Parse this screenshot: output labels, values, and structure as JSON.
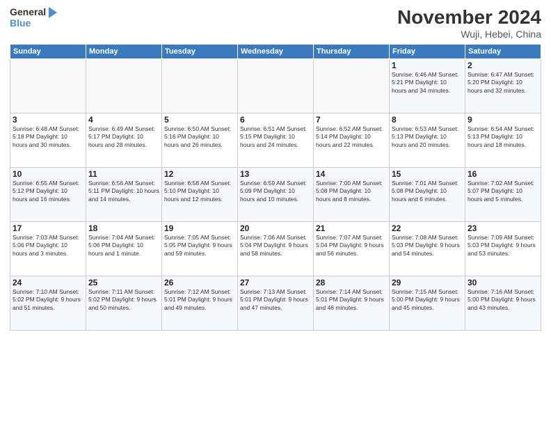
{
  "header": {
    "logo_general": "General",
    "logo_blue": "Blue",
    "month_title": "November 2024",
    "location": "Wuji, Hebei, China"
  },
  "weekdays": [
    "Sunday",
    "Monday",
    "Tuesday",
    "Wednesday",
    "Thursday",
    "Friday",
    "Saturday"
  ],
  "weeks": [
    [
      {
        "day": "",
        "info": ""
      },
      {
        "day": "",
        "info": ""
      },
      {
        "day": "",
        "info": ""
      },
      {
        "day": "",
        "info": ""
      },
      {
        "day": "",
        "info": ""
      },
      {
        "day": "1",
        "info": "Sunrise: 6:46 AM\nSunset: 5:21 PM\nDaylight: 10 hours\nand 34 minutes."
      },
      {
        "day": "2",
        "info": "Sunrise: 6:47 AM\nSunset: 5:20 PM\nDaylight: 10 hours\nand 32 minutes."
      }
    ],
    [
      {
        "day": "3",
        "info": "Sunrise: 6:48 AM\nSunset: 5:18 PM\nDaylight: 10 hours\nand 30 minutes."
      },
      {
        "day": "4",
        "info": "Sunrise: 6:49 AM\nSunset: 5:17 PM\nDaylight: 10 hours\nand 28 minutes."
      },
      {
        "day": "5",
        "info": "Sunrise: 6:50 AM\nSunset: 5:16 PM\nDaylight: 10 hours\nand 26 minutes."
      },
      {
        "day": "6",
        "info": "Sunrise: 6:51 AM\nSunset: 5:15 PM\nDaylight: 10 hours\nand 24 minutes."
      },
      {
        "day": "7",
        "info": "Sunrise: 6:52 AM\nSunset: 5:14 PM\nDaylight: 10 hours\nand 22 minutes."
      },
      {
        "day": "8",
        "info": "Sunrise: 6:53 AM\nSunset: 5:13 PM\nDaylight: 10 hours\nand 20 minutes."
      },
      {
        "day": "9",
        "info": "Sunrise: 6:54 AM\nSunset: 5:13 PM\nDaylight: 10 hours\nand 18 minutes."
      }
    ],
    [
      {
        "day": "10",
        "info": "Sunrise: 6:55 AM\nSunset: 5:12 PM\nDaylight: 10 hours\nand 16 minutes."
      },
      {
        "day": "11",
        "info": "Sunrise: 6:56 AM\nSunset: 5:11 PM\nDaylight: 10 hours\nand 14 minutes."
      },
      {
        "day": "12",
        "info": "Sunrise: 6:58 AM\nSunset: 5:10 PM\nDaylight: 10 hours\nand 12 minutes."
      },
      {
        "day": "13",
        "info": "Sunrise: 6:59 AM\nSunset: 5:09 PM\nDaylight: 10 hours\nand 10 minutes."
      },
      {
        "day": "14",
        "info": "Sunrise: 7:00 AM\nSunset: 5:08 PM\nDaylight: 10 hours\nand 8 minutes."
      },
      {
        "day": "15",
        "info": "Sunrise: 7:01 AM\nSunset: 5:08 PM\nDaylight: 10 hours\nand 6 minutes."
      },
      {
        "day": "16",
        "info": "Sunrise: 7:02 AM\nSunset: 5:07 PM\nDaylight: 10 hours\nand 5 minutes."
      }
    ],
    [
      {
        "day": "17",
        "info": "Sunrise: 7:03 AM\nSunset: 5:06 PM\nDaylight: 10 hours\nand 3 minutes."
      },
      {
        "day": "18",
        "info": "Sunrise: 7:04 AM\nSunset: 5:06 PM\nDaylight: 10 hours\nand 1 minute."
      },
      {
        "day": "19",
        "info": "Sunrise: 7:05 AM\nSunset: 5:05 PM\nDaylight: 9 hours\nand 59 minutes."
      },
      {
        "day": "20",
        "info": "Sunrise: 7:06 AM\nSunset: 5:04 PM\nDaylight: 9 hours\nand 58 minutes."
      },
      {
        "day": "21",
        "info": "Sunrise: 7:07 AM\nSunset: 5:04 PM\nDaylight: 9 hours\nand 56 minutes."
      },
      {
        "day": "22",
        "info": "Sunrise: 7:08 AM\nSunset: 5:03 PM\nDaylight: 9 hours\nand 54 minutes."
      },
      {
        "day": "23",
        "info": "Sunrise: 7:09 AM\nSunset: 5:03 PM\nDaylight: 9 hours\nand 53 minutes."
      }
    ],
    [
      {
        "day": "24",
        "info": "Sunrise: 7:10 AM\nSunset: 5:02 PM\nDaylight: 9 hours\nand 51 minutes."
      },
      {
        "day": "25",
        "info": "Sunrise: 7:11 AM\nSunset: 5:02 PM\nDaylight: 9 hours\nand 50 minutes."
      },
      {
        "day": "26",
        "info": "Sunrise: 7:12 AM\nSunset: 5:01 PM\nDaylight: 9 hours\nand 49 minutes."
      },
      {
        "day": "27",
        "info": "Sunrise: 7:13 AM\nSunset: 5:01 PM\nDaylight: 9 hours\nand 47 minutes."
      },
      {
        "day": "28",
        "info": "Sunrise: 7:14 AM\nSunset: 5:01 PM\nDaylight: 9 hours\nand 46 minutes."
      },
      {
        "day": "29",
        "info": "Sunrise: 7:15 AM\nSunset: 5:00 PM\nDaylight: 9 hours\nand 45 minutes."
      },
      {
        "day": "30",
        "info": "Sunrise: 7:16 AM\nSunset: 5:00 PM\nDaylight: 9 hours\nand 43 minutes."
      }
    ]
  ]
}
